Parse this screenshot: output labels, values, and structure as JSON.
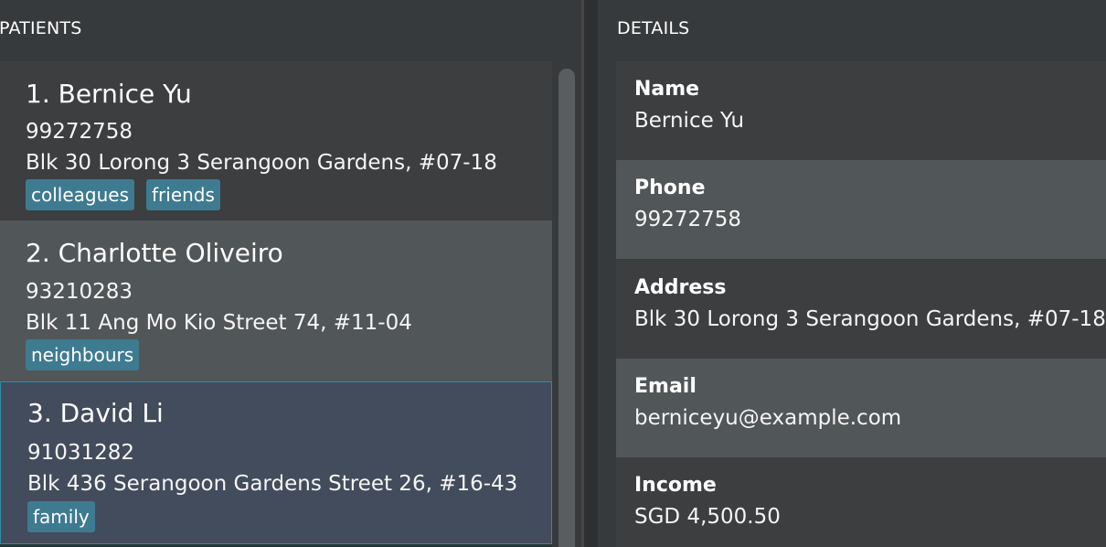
{
  "left_panel": {
    "title": "PATIENTS",
    "patients": [
      {
        "index_name": "1. Bernice Yu",
        "phone": "99272758",
        "address": "Blk 30 Lorong 3 Serangoon Gardens, #07-18",
        "tags": [
          "colleagues",
          "friends"
        ]
      },
      {
        "index_name": "2. Charlotte Oliveiro",
        "phone": "93210283",
        "address": "Blk 11 Ang Mo Kio Street 74, #11-04",
        "tags": [
          "neighbours"
        ]
      },
      {
        "index_name": "3. David Li",
        "phone": "91031282",
        "address": "Blk 436 Serangoon Gardens Street 26, #16-43",
        "tags": [
          "family"
        ]
      }
    ]
  },
  "right_panel": {
    "title": "DETAILS",
    "fields": [
      {
        "label": "Name",
        "value": "Bernice Yu"
      },
      {
        "label": "Phone",
        "value": "99272758"
      },
      {
        "label": "Address",
        "value": "Blk 30 Lorong 3 Serangoon Gardens, #07-18"
      },
      {
        "label": "Email",
        "value": "berniceyu@example.com"
      },
      {
        "label": "Income",
        "value": "SGD 4,500.50"
      }
    ]
  },
  "colors": {
    "background": "#373a3c",
    "card_dark": "#3c3e40",
    "card_light": "#515658",
    "card_selected": "#434c5c",
    "selected_border": "#2f8bab",
    "tag": "#3e7b91"
  }
}
